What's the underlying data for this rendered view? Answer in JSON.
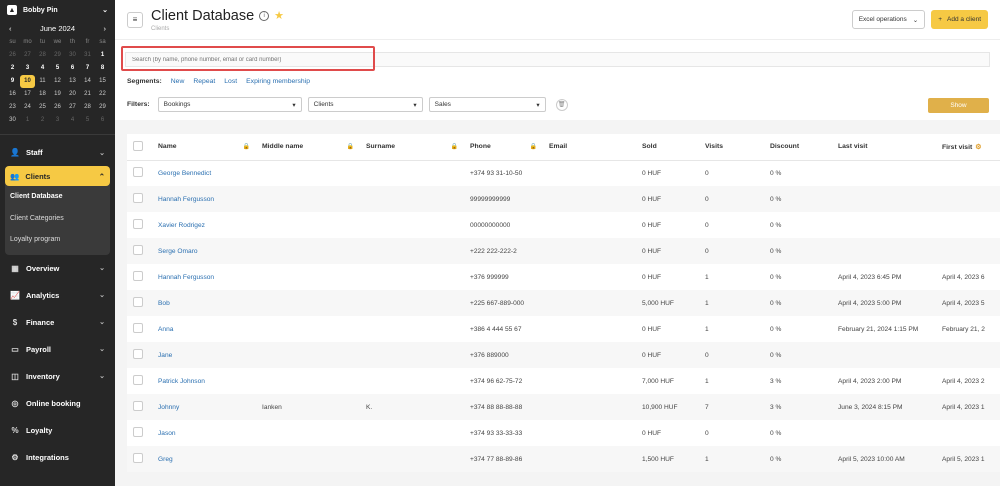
{
  "sidebar": {
    "user": "Bobby Pin",
    "calendar": {
      "month": "June 2024",
      "weekdays": [
        "su",
        "mo",
        "tu",
        "we",
        "th",
        "fr",
        "sa"
      ],
      "days": [
        {
          "d": "26",
          "c": "muted"
        },
        {
          "d": "27",
          "c": "muted"
        },
        {
          "d": "28",
          "c": "muted"
        },
        {
          "d": "29",
          "c": "muted"
        },
        {
          "d": "30",
          "c": "muted"
        },
        {
          "d": "31",
          "c": "muted"
        },
        {
          "d": "1",
          "c": "bold"
        },
        {
          "d": "2",
          "c": "bold"
        },
        {
          "d": "3",
          "c": "bold"
        },
        {
          "d": "4",
          "c": "bold"
        },
        {
          "d": "5",
          "c": "bold"
        },
        {
          "d": "6",
          "c": "bold"
        },
        {
          "d": "7",
          "c": "bold"
        },
        {
          "d": "8",
          "c": "bold"
        },
        {
          "d": "9",
          "c": "bold"
        },
        {
          "d": "10",
          "c": "today"
        },
        {
          "d": "11",
          "c": ""
        },
        {
          "d": "12",
          "c": ""
        },
        {
          "d": "13",
          "c": ""
        },
        {
          "d": "14",
          "c": ""
        },
        {
          "d": "15",
          "c": ""
        },
        {
          "d": "16",
          "c": ""
        },
        {
          "d": "17",
          "c": ""
        },
        {
          "d": "18",
          "c": ""
        },
        {
          "d": "19",
          "c": ""
        },
        {
          "d": "20",
          "c": ""
        },
        {
          "d": "21",
          "c": ""
        },
        {
          "d": "22",
          "c": ""
        },
        {
          "d": "23",
          "c": ""
        },
        {
          "d": "24",
          "c": ""
        },
        {
          "d": "25",
          "c": ""
        },
        {
          "d": "26",
          "c": ""
        },
        {
          "d": "27",
          "c": ""
        },
        {
          "d": "28",
          "c": ""
        },
        {
          "d": "29",
          "c": ""
        },
        {
          "d": "30",
          "c": ""
        },
        {
          "d": "1",
          "c": "muted"
        },
        {
          "d": "2",
          "c": "muted"
        },
        {
          "d": "3",
          "c": "muted"
        },
        {
          "d": "4",
          "c": "muted"
        },
        {
          "d": "5",
          "c": "muted"
        },
        {
          "d": "6",
          "c": "muted"
        }
      ]
    },
    "staff": "Staff",
    "clients": "Clients",
    "client_subitems": [
      "Client Database",
      "Client Categories",
      "Loyalty program"
    ],
    "items": [
      {
        "label": "Overview",
        "icon": "grid-icon",
        "glyph": "▦",
        "chev": true
      },
      {
        "label": "Analytics",
        "icon": "chart-icon",
        "glyph": "📈",
        "chev": true
      },
      {
        "label": "Finance",
        "icon": "dollar-icon",
        "glyph": "$",
        "chev": true
      },
      {
        "label": "Payroll",
        "icon": "wallet-icon",
        "glyph": "▭",
        "chev": true
      },
      {
        "label": "Inventory",
        "icon": "box-icon",
        "glyph": "◫",
        "chev": true
      },
      {
        "label": "Online booking",
        "icon": "globe-icon",
        "glyph": "◎",
        "chev": false
      },
      {
        "label": "Loyalty",
        "icon": "percent-icon",
        "glyph": "%",
        "chev": false
      },
      {
        "label": "Integrations",
        "icon": "plug-icon",
        "glyph": "⚙",
        "chev": false
      }
    ]
  },
  "header": {
    "title": "Client Database",
    "breadcrumb": "Clients",
    "excel_label": "Excel operations",
    "add_label": "Add a client"
  },
  "search": {
    "placeholder": "Search (by name, phone number, email or card number)"
  },
  "segments": {
    "label": "Segments:",
    "items": [
      "New",
      "Repeat",
      "Lost",
      "Expiring membership"
    ]
  },
  "filters": {
    "label": "Filters:",
    "selects": [
      {
        "value": "Bookings",
        "w": 144
      },
      {
        "value": "Clients",
        "w": 115
      },
      {
        "value": "Sales",
        "w": 117
      }
    ],
    "show_label": "Show"
  },
  "table": {
    "columns": [
      "Name",
      "Middle name",
      "Surname",
      "Phone",
      "Email",
      "Sold",
      "Visits",
      "Discount",
      "Last visit",
      "First visit"
    ],
    "rows": [
      [
        "George Bennedict",
        "",
        "",
        "+374 93 31-10-50",
        "",
        "0 HUF",
        "0",
        "0 %",
        "",
        ""
      ],
      [
        "Hannah Fergusson",
        "",
        "",
        "99999999999",
        "",
        "0 HUF",
        "0",
        "0 %",
        "",
        ""
      ],
      [
        "Xavier Rodrigez",
        "",
        "",
        "00000000000",
        "",
        "0 HUF",
        "0",
        "0 %",
        "",
        ""
      ],
      [
        "Serge Omaro",
        "",
        "",
        "+222 222-222-2",
        "",
        "0 HUF",
        "0",
        "0 %",
        "",
        ""
      ],
      [
        "Hannah Fergusson",
        "",
        "",
        "+376 999999",
        "",
        "0 HUF",
        "1",
        "0 %",
        "April 4, 2023 6:45 PM",
        "April 4, 2023 6"
      ],
      [
        "Bob",
        "",
        "",
        "+225 667-889-000",
        "",
        "5,000 HUF",
        "1",
        "0 %",
        "April 4, 2023 5:00 PM",
        "April 4, 2023 5"
      ],
      [
        "Anna",
        "",
        "",
        "+386 4 444 55 67",
        "",
        "0 HUF",
        "1",
        "0 %",
        "February 21, 2024 1:15 PM",
        "February 21, 2"
      ],
      [
        "Jane",
        "",
        "",
        "+376 889000",
        "",
        "0 HUF",
        "0",
        "0 %",
        "",
        ""
      ],
      [
        "Patrick Johnson",
        "",
        "",
        "+374 96 62-75-72",
        "",
        "7,000 HUF",
        "1",
        "3 %",
        "April 4, 2023 2:00 PM",
        "April 4, 2023 2"
      ],
      [
        "Johnny",
        "Ianken",
        "K.",
        "+374 88 88-88-88",
        "",
        "10,900 HUF",
        "7",
        "3 %",
        "June 3, 2024 8:15 PM",
        "April 4, 2023 1"
      ],
      [
        "Jason",
        "",
        "",
        "+374 93 33-33-33",
        "",
        "0 HUF",
        "0",
        "0 %",
        "",
        ""
      ],
      [
        "Greg",
        "",
        "",
        "+374 77 88-89-86",
        "",
        "1,500 HUF",
        "1",
        "0 %",
        "April 5, 2023 10:00 AM",
        "April 5, 2023 1"
      ]
    ]
  }
}
